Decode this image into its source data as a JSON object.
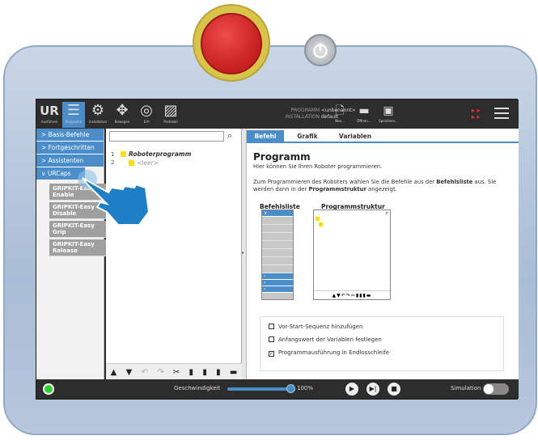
{
  "topbar": {
    "tabs": [
      {
        "label": "Ausführen",
        "icon": "ur-logo-icon"
      },
      {
        "label": "Programm",
        "icon": "program-icon"
      },
      {
        "label": "Installation",
        "icon": "installation-icon"
      },
      {
        "label": "Bewegen",
        "icon": "move-icon"
      },
      {
        "label": "E/A",
        "icon": "io-icon"
      },
      {
        "label": "Protokoll",
        "icon": "log-icon"
      }
    ],
    "program_label": "PROGRAMM",
    "program_value": "<unbenannt>",
    "installation_label": "INSTALLATION",
    "installation_value": "default",
    "new_label": "Neu...",
    "open_label": "Öffnen...",
    "save_label": "Speichern..."
  },
  "sidebar": {
    "categories": [
      "Basis-Befehle",
      "Fortgeschritten",
      "Assistenten",
      "URCaps"
    ],
    "subitems": [
      "GRIPKIT-Easy Enable",
      "GRIPKIT-Easy Disable",
      "GRIPKIT-Easy Grip",
      "GRIPKIT-Easy Release"
    ]
  },
  "tree": {
    "lines": [
      "1",
      "2"
    ],
    "root": "Roboterprogramm",
    "empty": "<leer>"
  },
  "right": {
    "tabs": [
      "Befehl",
      "Grafik",
      "Variablen"
    ],
    "heading": "Programm",
    "intro": "Hier können Sie Ihren Roboter programmieren.",
    "desc_part1": "Zum Programmieren des Roboters wählen Sie die Befehle aus der ",
    "desc_bold": "Befehlsliste",
    "desc_part2": " aus. Sie werden dann in der ",
    "desc_bold2": "Programmstruktur",
    "desc_part3": " angezeigt.",
    "befehlsliste": "Befehlsliste",
    "programmstruktur": "Programmstruktur",
    "options": [
      {
        "label": "Vor-Start-Sequenz hinzufügen",
        "checked": false
      },
      {
        "label": "Anfangswert der Variablen festlegen",
        "checked": false
      },
      {
        "label": "Programmausführung in Endlosschleife",
        "checked": true
      }
    ]
  },
  "bottom": {
    "speed_label": "Geschwindigkeit",
    "speed_value": "100%",
    "simulation_label": "Simulation"
  },
  "colors": {
    "accent": "#4a8dc8",
    "estop": "#d42424",
    "running": "#2cd12c"
  }
}
